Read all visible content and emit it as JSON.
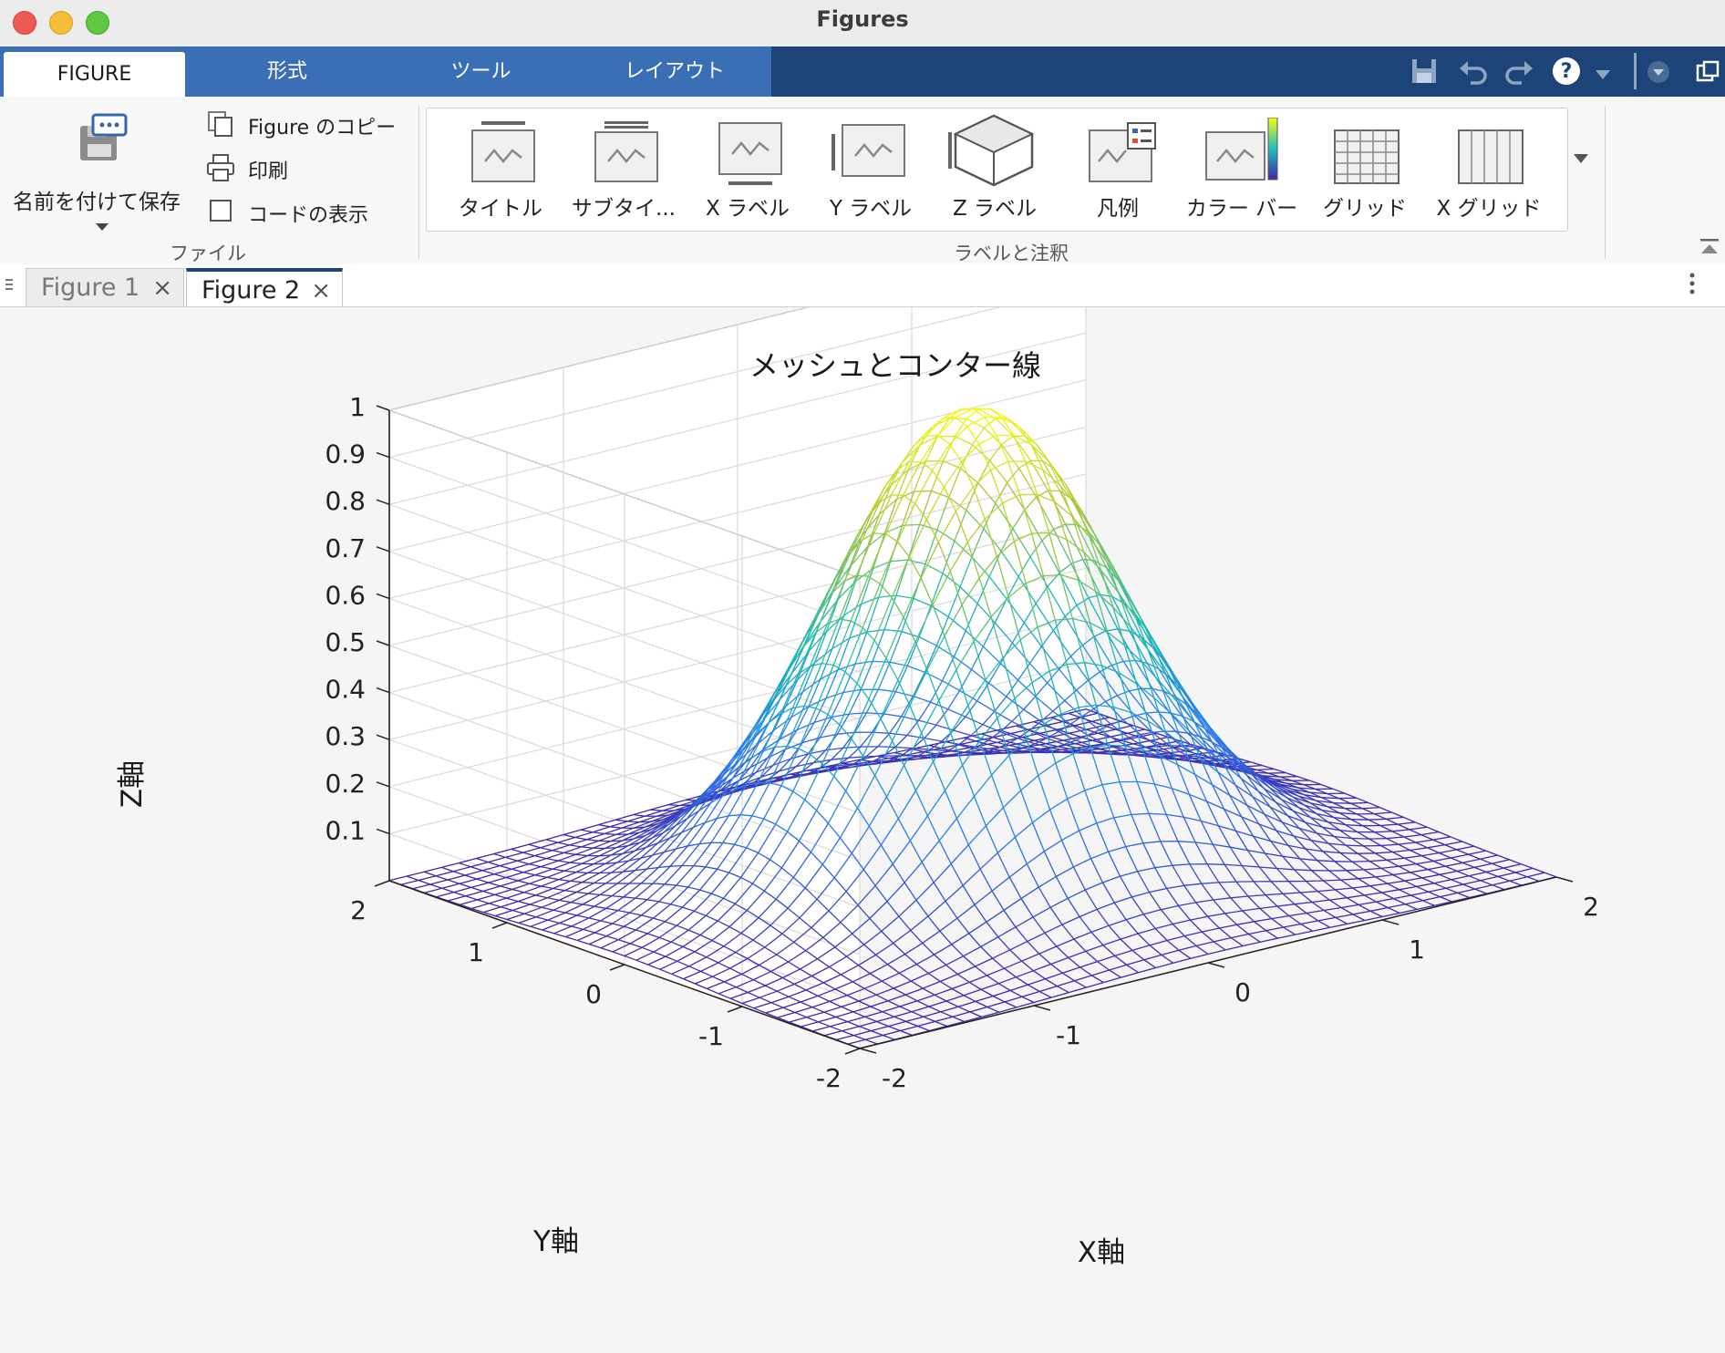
{
  "window": {
    "title": "Figures"
  },
  "ribbon_tabs": [
    {
      "label": "FIGURE",
      "active": true
    },
    {
      "label": "形式"
    },
    {
      "label": "ツール"
    },
    {
      "label": "レイアウト"
    }
  ],
  "quick_access": {
    "help": "?"
  },
  "file_group": {
    "save_label": "名前を付けて保存",
    "copy_label": "Figure のコピー",
    "print_label": "印刷",
    "show_code_label": "コードの表示",
    "group_label": "ファイル"
  },
  "annot_group": {
    "group_label": "ラベルと注釈",
    "items": [
      {
        "label": "タイトル",
        "icon": "title-icon"
      },
      {
        "label": "サブタイ...",
        "icon": "subtitle-icon"
      },
      {
        "label": "X ラベル",
        "icon": "xlabel-icon"
      },
      {
        "label": "Y ラベル",
        "icon": "ylabel-icon"
      },
      {
        "label": "Z ラベル",
        "icon": "zlabel-icon"
      },
      {
        "label": "凡例",
        "icon": "legend-icon"
      },
      {
        "label": "カラー バー",
        "icon": "colorbar-icon"
      },
      {
        "label": "グリッド",
        "icon": "grid-icon"
      },
      {
        "label": "X グリッド",
        "icon": "xgrid-icon"
      }
    ]
  },
  "doc_tabs": [
    {
      "label": "Figure 1",
      "active": false
    },
    {
      "label": "Figure 2",
      "active": true
    }
  ],
  "chart_data": {
    "type": "surface-mesh",
    "function": "z = exp(-(x^2 + y^2))",
    "title": "メッシュとコンター線",
    "xlabel": "X軸",
    "ylabel": "Y軸",
    "zlabel": "Z軸",
    "xlim": [
      -2,
      2
    ],
    "ylim": [
      -2,
      2
    ],
    "zlim": [
      0,
      1
    ],
    "x_ticks": [
      "-2",
      "-1",
      "0",
      "1",
      "2"
    ],
    "y_ticks": [
      "-2",
      "-1",
      "0",
      "1",
      "2"
    ],
    "z_ticks": [
      "0.1",
      "0.2",
      "0.3",
      "0.4",
      "0.5",
      "0.6",
      "0.7",
      "0.8",
      "0.9",
      "1"
    ],
    "grid": true,
    "colormap": "parula",
    "colormap_low": "#3e26a8",
    "colormap_high": "#f9fb0e"
  }
}
